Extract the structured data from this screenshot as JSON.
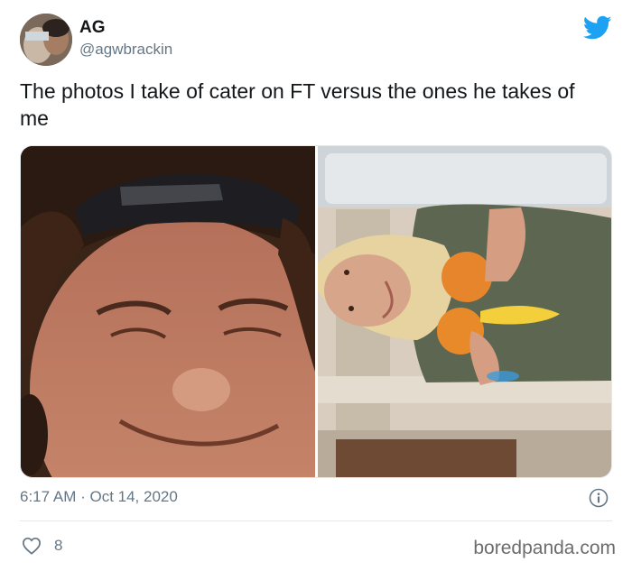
{
  "author": {
    "name": "AG",
    "handle": "@agwbrackin"
  },
  "tweet": {
    "text": "The photos I take of cater on FT versus the ones he takes of me",
    "timestamp": "6:17 AM · Oct 14, 2020",
    "likes": "8"
  },
  "media": {
    "left_photo": "selfie-photo",
    "right_photo": "upside-down-photo"
  },
  "icons": {
    "brand": "twitter-bird-icon",
    "info": "info-icon",
    "like": "heart-icon"
  },
  "colors": {
    "twitter_blue": "#1da1f2",
    "secondary_text": "#657786"
  },
  "watermark": "boredpanda.com"
}
